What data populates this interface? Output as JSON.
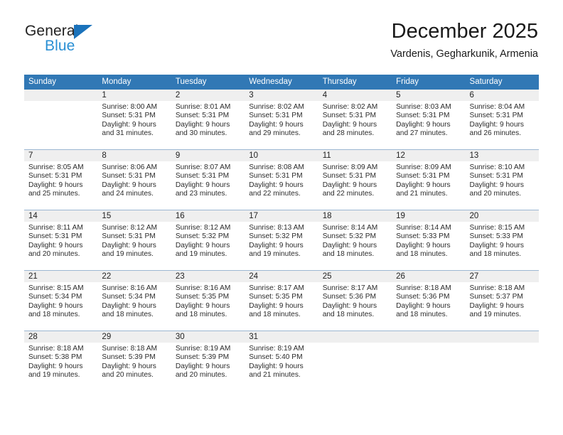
{
  "brand": {
    "name_part1": "General",
    "name_part2": "Blue",
    "color_dark": "#222222",
    "color_blue": "#2a8fd4",
    "triangle_color": "#1a72bb"
  },
  "header": {
    "title": "December 2025",
    "subtitle": "Vardenis, Gegharkunik, Armenia"
  },
  "calendar": {
    "header_bg": "#3178b5",
    "header_text_color": "#ffffff",
    "daynum_bg": "#efefef",
    "row_border_color": "#9cb7d2",
    "weekdays": [
      "Sunday",
      "Monday",
      "Tuesday",
      "Wednesday",
      "Thursday",
      "Friday",
      "Saturday"
    ],
    "weeks": [
      [
        {
          "day": "",
          "sunrise": "",
          "sunset": "",
          "daylight_line1": "",
          "daylight_line2": "",
          "empty": true
        },
        {
          "day": "1",
          "sunrise": "Sunrise: 8:00 AM",
          "sunset": "Sunset: 5:31 PM",
          "daylight_line1": "Daylight: 9 hours",
          "daylight_line2": "and 31 minutes."
        },
        {
          "day": "2",
          "sunrise": "Sunrise: 8:01 AM",
          "sunset": "Sunset: 5:31 PM",
          "daylight_line1": "Daylight: 9 hours",
          "daylight_line2": "and 30 minutes."
        },
        {
          "day": "3",
          "sunrise": "Sunrise: 8:02 AM",
          "sunset": "Sunset: 5:31 PM",
          "daylight_line1": "Daylight: 9 hours",
          "daylight_line2": "and 29 minutes."
        },
        {
          "day": "4",
          "sunrise": "Sunrise: 8:02 AM",
          "sunset": "Sunset: 5:31 PM",
          "daylight_line1": "Daylight: 9 hours",
          "daylight_line2": "and 28 minutes."
        },
        {
          "day": "5",
          "sunrise": "Sunrise: 8:03 AM",
          "sunset": "Sunset: 5:31 PM",
          "daylight_line1": "Daylight: 9 hours",
          "daylight_line2": "and 27 minutes."
        },
        {
          "day": "6",
          "sunrise": "Sunrise: 8:04 AM",
          "sunset": "Sunset: 5:31 PM",
          "daylight_line1": "Daylight: 9 hours",
          "daylight_line2": "and 26 minutes."
        }
      ],
      [
        {
          "day": "7",
          "sunrise": "Sunrise: 8:05 AM",
          "sunset": "Sunset: 5:31 PM",
          "daylight_line1": "Daylight: 9 hours",
          "daylight_line2": "and 25 minutes."
        },
        {
          "day": "8",
          "sunrise": "Sunrise: 8:06 AM",
          "sunset": "Sunset: 5:31 PM",
          "daylight_line1": "Daylight: 9 hours",
          "daylight_line2": "and 24 minutes."
        },
        {
          "day": "9",
          "sunrise": "Sunrise: 8:07 AM",
          "sunset": "Sunset: 5:31 PM",
          "daylight_line1": "Daylight: 9 hours",
          "daylight_line2": "and 23 minutes."
        },
        {
          "day": "10",
          "sunrise": "Sunrise: 8:08 AM",
          "sunset": "Sunset: 5:31 PM",
          "daylight_line1": "Daylight: 9 hours",
          "daylight_line2": "and 22 minutes."
        },
        {
          "day": "11",
          "sunrise": "Sunrise: 8:09 AM",
          "sunset": "Sunset: 5:31 PM",
          "daylight_line1": "Daylight: 9 hours",
          "daylight_line2": "and 22 minutes."
        },
        {
          "day": "12",
          "sunrise": "Sunrise: 8:09 AM",
          "sunset": "Sunset: 5:31 PM",
          "daylight_line1": "Daylight: 9 hours",
          "daylight_line2": "and 21 minutes."
        },
        {
          "day": "13",
          "sunrise": "Sunrise: 8:10 AM",
          "sunset": "Sunset: 5:31 PM",
          "daylight_line1": "Daylight: 9 hours",
          "daylight_line2": "and 20 minutes."
        }
      ],
      [
        {
          "day": "14",
          "sunrise": "Sunrise: 8:11 AM",
          "sunset": "Sunset: 5:31 PM",
          "daylight_line1": "Daylight: 9 hours",
          "daylight_line2": "and 20 minutes."
        },
        {
          "day": "15",
          "sunrise": "Sunrise: 8:12 AM",
          "sunset": "Sunset: 5:31 PM",
          "daylight_line1": "Daylight: 9 hours",
          "daylight_line2": "and 19 minutes."
        },
        {
          "day": "16",
          "sunrise": "Sunrise: 8:12 AM",
          "sunset": "Sunset: 5:32 PM",
          "daylight_line1": "Daylight: 9 hours",
          "daylight_line2": "and 19 minutes."
        },
        {
          "day": "17",
          "sunrise": "Sunrise: 8:13 AM",
          "sunset": "Sunset: 5:32 PM",
          "daylight_line1": "Daylight: 9 hours",
          "daylight_line2": "and 19 minutes."
        },
        {
          "day": "18",
          "sunrise": "Sunrise: 8:14 AM",
          "sunset": "Sunset: 5:32 PM",
          "daylight_line1": "Daylight: 9 hours",
          "daylight_line2": "and 18 minutes."
        },
        {
          "day": "19",
          "sunrise": "Sunrise: 8:14 AM",
          "sunset": "Sunset: 5:33 PM",
          "daylight_line1": "Daylight: 9 hours",
          "daylight_line2": "and 18 minutes."
        },
        {
          "day": "20",
          "sunrise": "Sunrise: 8:15 AM",
          "sunset": "Sunset: 5:33 PM",
          "daylight_line1": "Daylight: 9 hours",
          "daylight_line2": "and 18 minutes."
        }
      ],
      [
        {
          "day": "21",
          "sunrise": "Sunrise: 8:15 AM",
          "sunset": "Sunset: 5:34 PM",
          "daylight_line1": "Daylight: 9 hours",
          "daylight_line2": "and 18 minutes."
        },
        {
          "day": "22",
          "sunrise": "Sunrise: 8:16 AM",
          "sunset": "Sunset: 5:34 PM",
          "daylight_line1": "Daylight: 9 hours",
          "daylight_line2": "and 18 minutes."
        },
        {
          "day": "23",
          "sunrise": "Sunrise: 8:16 AM",
          "sunset": "Sunset: 5:35 PM",
          "daylight_line1": "Daylight: 9 hours",
          "daylight_line2": "and 18 minutes."
        },
        {
          "day": "24",
          "sunrise": "Sunrise: 8:17 AM",
          "sunset": "Sunset: 5:35 PM",
          "daylight_line1": "Daylight: 9 hours",
          "daylight_line2": "and 18 minutes."
        },
        {
          "day": "25",
          "sunrise": "Sunrise: 8:17 AM",
          "sunset": "Sunset: 5:36 PM",
          "daylight_line1": "Daylight: 9 hours",
          "daylight_line2": "and 18 minutes."
        },
        {
          "day": "26",
          "sunrise": "Sunrise: 8:18 AM",
          "sunset": "Sunset: 5:36 PM",
          "daylight_line1": "Daylight: 9 hours",
          "daylight_line2": "and 18 minutes."
        },
        {
          "day": "27",
          "sunrise": "Sunrise: 8:18 AM",
          "sunset": "Sunset: 5:37 PM",
          "daylight_line1": "Daylight: 9 hours",
          "daylight_line2": "and 19 minutes."
        }
      ],
      [
        {
          "day": "28",
          "sunrise": "Sunrise: 8:18 AM",
          "sunset": "Sunset: 5:38 PM",
          "daylight_line1": "Daylight: 9 hours",
          "daylight_line2": "and 19 minutes."
        },
        {
          "day": "29",
          "sunrise": "Sunrise: 8:18 AM",
          "sunset": "Sunset: 5:39 PM",
          "daylight_line1": "Daylight: 9 hours",
          "daylight_line2": "and 20 minutes."
        },
        {
          "day": "30",
          "sunrise": "Sunrise: 8:19 AM",
          "sunset": "Sunset: 5:39 PM",
          "daylight_line1": "Daylight: 9 hours",
          "daylight_line2": "and 20 minutes."
        },
        {
          "day": "31",
          "sunrise": "Sunrise: 8:19 AM",
          "sunset": "Sunset: 5:40 PM",
          "daylight_line1": "Daylight: 9 hours",
          "daylight_line2": "and 21 minutes."
        },
        {
          "day": "",
          "sunrise": "",
          "sunset": "",
          "daylight_line1": "",
          "daylight_line2": "",
          "empty": true
        },
        {
          "day": "",
          "sunrise": "",
          "sunset": "",
          "daylight_line1": "",
          "daylight_line2": "",
          "empty": true
        },
        {
          "day": "",
          "sunrise": "",
          "sunset": "",
          "daylight_line1": "",
          "daylight_line2": "",
          "empty": true
        }
      ]
    ]
  }
}
